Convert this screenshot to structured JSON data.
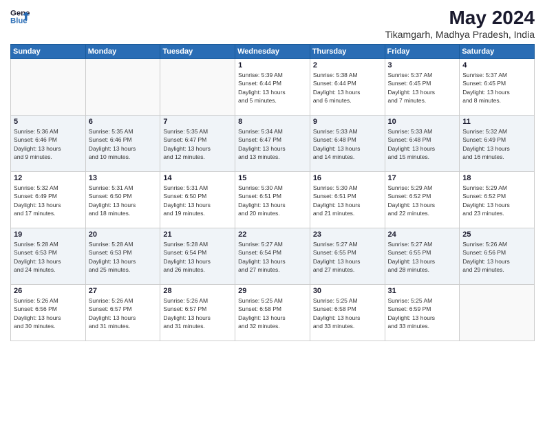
{
  "header": {
    "logo_line1": "General",
    "logo_line2": "Blue",
    "title": "May 2024",
    "subtitle": "Tikamgarh, Madhya Pradesh, India"
  },
  "weekdays": [
    "Sunday",
    "Monday",
    "Tuesday",
    "Wednesday",
    "Thursday",
    "Friday",
    "Saturday"
  ],
  "weeks": [
    [
      {
        "day": "",
        "info": ""
      },
      {
        "day": "",
        "info": ""
      },
      {
        "day": "",
        "info": ""
      },
      {
        "day": "1",
        "info": "Sunrise: 5:39 AM\nSunset: 6:44 PM\nDaylight: 13 hours\nand 5 minutes."
      },
      {
        "day": "2",
        "info": "Sunrise: 5:38 AM\nSunset: 6:44 PM\nDaylight: 13 hours\nand 6 minutes."
      },
      {
        "day": "3",
        "info": "Sunrise: 5:37 AM\nSunset: 6:45 PM\nDaylight: 13 hours\nand 7 minutes."
      },
      {
        "day": "4",
        "info": "Sunrise: 5:37 AM\nSunset: 6:45 PM\nDaylight: 13 hours\nand 8 minutes."
      }
    ],
    [
      {
        "day": "5",
        "info": "Sunrise: 5:36 AM\nSunset: 6:46 PM\nDaylight: 13 hours\nand 9 minutes."
      },
      {
        "day": "6",
        "info": "Sunrise: 5:35 AM\nSunset: 6:46 PM\nDaylight: 13 hours\nand 10 minutes."
      },
      {
        "day": "7",
        "info": "Sunrise: 5:35 AM\nSunset: 6:47 PM\nDaylight: 13 hours\nand 12 minutes."
      },
      {
        "day": "8",
        "info": "Sunrise: 5:34 AM\nSunset: 6:47 PM\nDaylight: 13 hours\nand 13 minutes."
      },
      {
        "day": "9",
        "info": "Sunrise: 5:33 AM\nSunset: 6:48 PM\nDaylight: 13 hours\nand 14 minutes."
      },
      {
        "day": "10",
        "info": "Sunrise: 5:33 AM\nSunset: 6:48 PM\nDaylight: 13 hours\nand 15 minutes."
      },
      {
        "day": "11",
        "info": "Sunrise: 5:32 AM\nSunset: 6:49 PM\nDaylight: 13 hours\nand 16 minutes."
      }
    ],
    [
      {
        "day": "12",
        "info": "Sunrise: 5:32 AM\nSunset: 6:49 PM\nDaylight: 13 hours\nand 17 minutes."
      },
      {
        "day": "13",
        "info": "Sunrise: 5:31 AM\nSunset: 6:50 PM\nDaylight: 13 hours\nand 18 minutes."
      },
      {
        "day": "14",
        "info": "Sunrise: 5:31 AM\nSunset: 6:50 PM\nDaylight: 13 hours\nand 19 minutes."
      },
      {
        "day": "15",
        "info": "Sunrise: 5:30 AM\nSunset: 6:51 PM\nDaylight: 13 hours\nand 20 minutes."
      },
      {
        "day": "16",
        "info": "Sunrise: 5:30 AM\nSunset: 6:51 PM\nDaylight: 13 hours\nand 21 minutes."
      },
      {
        "day": "17",
        "info": "Sunrise: 5:29 AM\nSunset: 6:52 PM\nDaylight: 13 hours\nand 22 minutes."
      },
      {
        "day": "18",
        "info": "Sunrise: 5:29 AM\nSunset: 6:52 PM\nDaylight: 13 hours\nand 23 minutes."
      }
    ],
    [
      {
        "day": "19",
        "info": "Sunrise: 5:28 AM\nSunset: 6:53 PM\nDaylight: 13 hours\nand 24 minutes."
      },
      {
        "day": "20",
        "info": "Sunrise: 5:28 AM\nSunset: 6:53 PM\nDaylight: 13 hours\nand 25 minutes."
      },
      {
        "day": "21",
        "info": "Sunrise: 5:28 AM\nSunset: 6:54 PM\nDaylight: 13 hours\nand 26 minutes."
      },
      {
        "day": "22",
        "info": "Sunrise: 5:27 AM\nSunset: 6:54 PM\nDaylight: 13 hours\nand 27 minutes."
      },
      {
        "day": "23",
        "info": "Sunrise: 5:27 AM\nSunset: 6:55 PM\nDaylight: 13 hours\nand 27 minutes."
      },
      {
        "day": "24",
        "info": "Sunrise: 5:27 AM\nSunset: 6:55 PM\nDaylight: 13 hours\nand 28 minutes."
      },
      {
        "day": "25",
        "info": "Sunrise: 5:26 AM\nSunset: 6:56 PM\nDaylight: 13 hours\nand 29 minutes."
      }
    ],
    [
      {
        "day": "26",
        "info": "Sunrise: 5:26 AM\nSunset: 6:56 PM\nDaylight: 13 hours\nand 30 minutes."
      },
      {
        "day": "27",
        "info": "Sunrise: 5:26 AM\nSunset: 6:57 PM\nDaylight: 13 hours\nand 31 minutes."
      },
      {
        "day": "28",
        "info": "Sunrise: 5:26 AM\nSunset: 6:57 PM\nDaylight: 13 hours\nand 31 minutes."
      },
      {
        "day": "29",
        "info": "Sunrise: 5:25 AM\nSunset: 6:58 PM\nDaylight: 13 hours\nand 32 minutes."
      },
      {
        "day": "30",
        "info": "Sunrise: 5:25 AM\nSunset: 6:58 PM\nDaylight: 13 hours\nand 33 minutes."
      },
      {
        "day": "31",
        "info": "Sunrise: 5:25 AM\nSunset: 6:59 PM\nDaylight: 13 hours\nand 33 minutes."
      },
      {
        "day": "",
        "info": ""
      }
    ]
  ]
}
